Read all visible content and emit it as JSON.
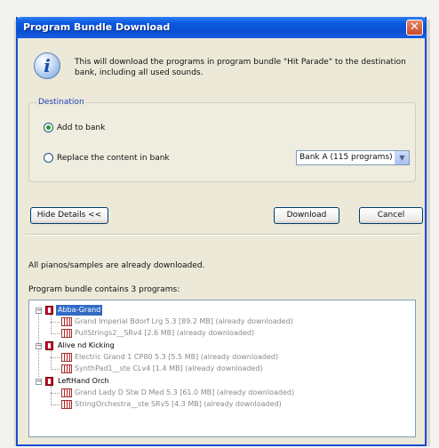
{
  "window": {
    "title": "Program Bundle Download"
  },
  "message": "This will download the programs in program bundle \"Hit Parade\" to the destination bank, including all used sounds.",
  "destination": {
    "legend": "Destination",
    "option_add": "Add to bank",
    "option_replace": "Replace the content in bank",
    "selected_option": "Add to bank",
    "bank_select": "Bank A (115 programs)"
  },
  "buttons": {
    "hide_details": "Hide Details <<",
    "download": "Download",
    "cancel": "Cancel"
  },
  "status": {
    "samples": "All pianos/samples are already downloaded.",
    "summary": "Program bundle contains 3 programs:"
  },
  "tree": [
    {
      "program": "Abba-Grand",
      "selected": true,
      "sounds": [
        "Grand Imperial Bdorf Lrg 5.3 [89.2 MB] (already downloaded)",
        "PullStrings2__SRv4 [2.6 MB] (already downloaded)"
      ]
    },
    {
      "program": "Alive nd Kicking",
      "selected": false,
      "sounds": [
        "Electric Grand 1 CP80 5.3 [5.5 MB] (already downloaded)",
        "SynthPad1__ste CLv4 [1.4 MB] (already downloaded)"
      ]
    },
    {
      "program": "LeftHand Orch",
      "selected": false,
      "sounds": [
        "Grand Lady D Stw D Med 5.3 [61.0 MB] (already downloaded)",
        "StringOrchestra__ste SRv5 [4.3 MB] (already downloaded)"
      ]
    }
  ],
  "icons": {
    "info": "info-icon",
    "close": "close-icon",
    "program": "program-icon",
    "sound": "sound-icon",
    "dropdown": "chevron-down-icon"
  }
}
